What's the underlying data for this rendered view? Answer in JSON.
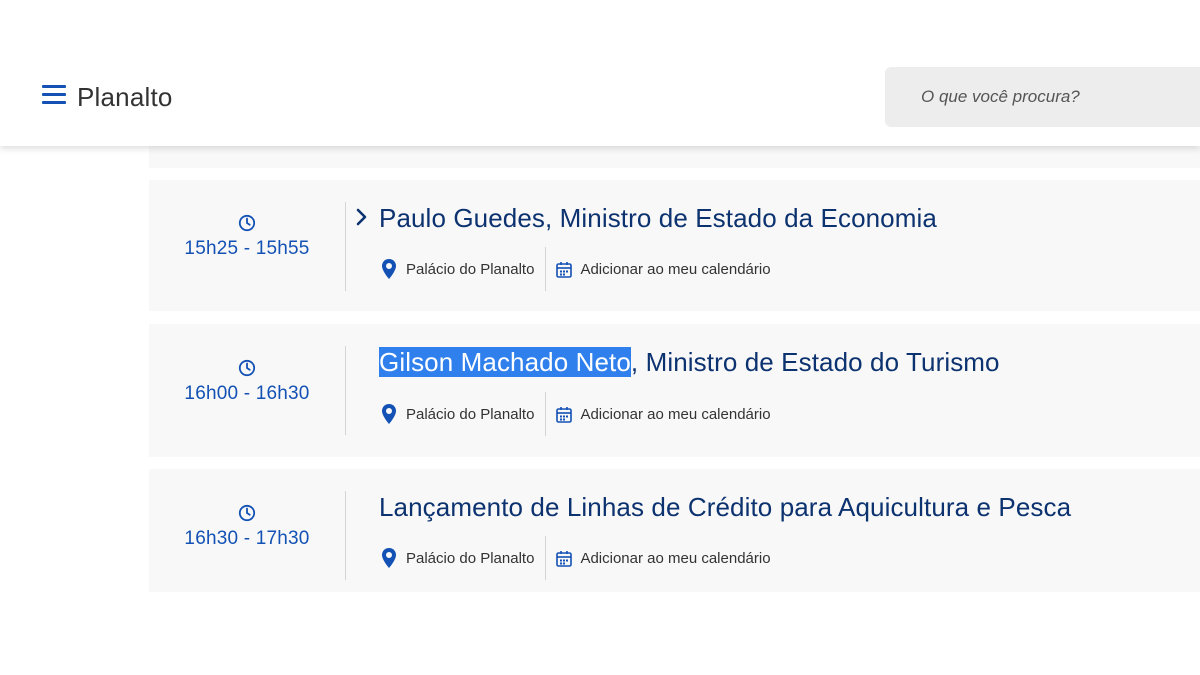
{
  "header": {
    "site_title": "Planalto",
    "search_placeholder": "O que você procura?"
  },
  "icons": {
    "menu": "hamburger-icon",
    "time": "clock-icon",
    "location": "map-pin-icon",
    "calendar": "calendar-icon",
    "expand": "chevron-right-icon"
  },
  "colors": {
    "accent": "#1351b4",
    "title": "#0c326f",
    "card_bg": "#f8f8f8",
    "highlight": "#2f80ed"
  },
  "events": [
    {
      "time": "15h25 - 15h55",
      "title": "Paulo Guedes, Ministro de Estado da Economia",
      "location": "Palácio do Planalto",
      "calendar_link": "Adicionar ao meu calendário"
    },
    {
      "time": "16h00 - 16h30",
      "title_highlight": "Gilson Machado Neto",
      "title_rest": ", Ministro de Estado do Turismo",
      "location": "Palácio do Planalto",
      "calendar_link": "Adicionar ao meu calendário"
    },
    {
      "time": "16h30 - 17h30",
      "title": "Lançamento de Linhas de Crédito para Aquicultura e Pesca",
      "location": "Palácio do Planalto",
      "calendar_link": "Adicionar ao meu calendário"
    }
  ]
}
